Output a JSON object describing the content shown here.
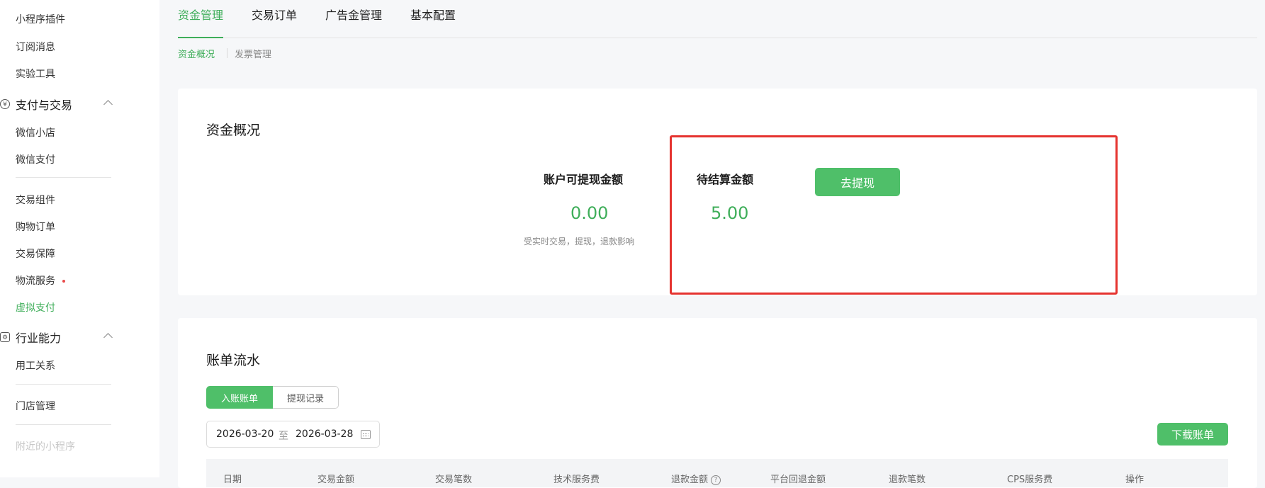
{
  "sidebar": {
    "items": [
      {
        "label": "小程序插件"
      },
      {
        "label": "订阅消息"
      },
      {
        "label": "实验工具"
      }
    ],
    "group_payment": {
      "label": "支付与交易"
    },
    "payment_items": [
      {
        "label": "微信小店"
      },
      {
        "label": "微信支付"
      }
    ],
    "trade_items": [
      {
        "label": "交易组件"
      },
      {
        "label": "购物订单"
      },
      {
        "label": "交易保障"
      },
      {
        "label": "物流服务"
      },
      {
        "label": "虚拟支付"
      }
    ],
    "group_industry": {
      "label": "行业能力"
    },
    "industry_items": [
      {
        "label": "用工关系"
      }
    ],
    "store": {
      "label": "门店管理"
    },
    "nearby": {
      "label": "附近的小程序"
    }
  },
  "tabs": [
    {
      "label": "资金管理",
      "active": true
    },
    {
      "label": "交易订单"
    },
    {
      "label": "广告金管理"
    },
    {
      "label": "基本配置"
    }
  ],
  "subtabs": [
    {
      "label": "资金概况",
      "active": true
    },
    {
      "label": "发票管理"
    }
  ],
  "overview": {
    "title": "资金概况",
    "withdrawable": {
      "label": "账户可提现金额",
      "value": "0.00",
      "note": "受实时交易，提现，退款影响"
    },
    "pending": {
      "label": "待结算金额",
      "value": "5.00"
    },
    "withdraw_button": "去提现"
  },
  "statement": {
    "title": "账单流水",
    "segments": [
      {
        "label": "入账账单",
        "active": true
      },
      {
        "label": "提现记录"
      }
    ],
    "date_start": "2026-03-20",
    "date_sep": "至",
    "date_end": "2026-03-28",
    "download_button": "下载账单",
    "columns": [
      "日期",
      "交易金额",
      "交易笔数",
      "技术服务费",
      "退款金额",
      "平台回退金额",
      "退款笔数",
      "CPS服务费",
      "操作"
    ]
  },
  "colors": {
    "accent": "#3fae5a",
    "button": "#4fbf69",
    "highlight": "#e5332f"
  }
}
